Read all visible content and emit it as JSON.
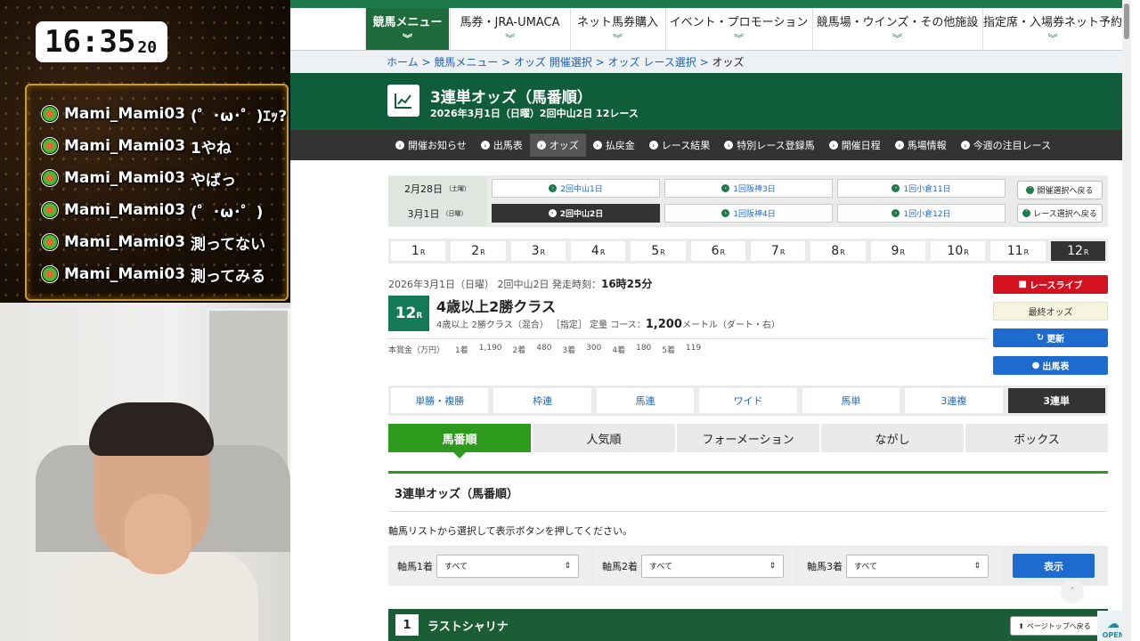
{
  "stream": {
    "clock": {
      "hm": "16:35",
      "ss": "20"
    },
    "chat": [
      {
        "user": "Mami_Mami03",
        "text": "(゜･ω･゜)ｴｯ?"
      },
      {
        "user": "Mami_Mami03",
        "text": "1やね"
      },
      {
        "user": "Mami_Mami03",
        "text": "やばっ"
      },
      {
        "user": "Mami_Mami03",
        "text": "(゜･ω･゜)"
      },
      {
        "user": "Mami_Mami03",
        "text": "測ってない"
      },
      {
        "user": "Mami_Mami03",
        "text": "測ってみる"
      }
    ]
  },
  "topnav": [
    {
      "label": "競馬メニュー"
    },
    {
      "label": "馬券・JRA-UMACA"
    },
    {
      "label": "ネット馬券購入"
    },
    {
      "label": "イベント・プロモーション"
    },
    {
      "label": "競馬場・ウインズ・その他施設"
    },
    {
      "label": "指定席・入場券ネット予約"
    }
  ],
  "breadcrumb": [
    "ホーム",
    "競馬メニュー",
    "オッズ 開催選択",
    "オッズ レース選択",
    "オッズ"
  ],
  "header": {
    "title": "3連単オッズ（馬番順）",
    "subtitle": "2026年3月1日（日曜）2回中山2日 12レース"
  },
  "subnav": [
    "開催お知らせ",
    "出馬表",
    "オッズ",
    "払戻金",
    "レース結果",
    "特別レース登録馬",
    "開催日程",
    "馬場情報",
    "今週の注目レース"
  ],
  "dates": [
    {
      "label": "2月28日",
      "dow": "（土曜）",
      "venues": [
        "2回中山1日",
        "1回阪神3日",
        "1回小倉11日"
      ]
    },
    {
      "label": "3月1日",
      "dow": "（日曜）",
      "venues": [
        "2回中山2日",
        "1回阪神4日",
        "1回小倉12日"
      ]
    }
  ],
  "back_buttons": [
    "開催選択へ戻る",
    "レース選択へ戻る"
  ],
  "races": [
    "1",
    "2",
    "3",
    "4",
    "5",
    "6",
    "7",
    "8",
    "9",
    "10",
    "11",
    "12"
  ],
  "race_suffix": "R",
  "race": {
    "date_line": "2026年3月1日（日曜） 2回中山2日 発走時刻：",
    "start_time": "16時25分",
    "num": "12",
    "name": "4歳以上2勝クラス",
    "conditions": "4歳以上 2勝クラス（混合） ［指定］ 定量 コース：",
    "distance": "1,200",
    "course_unit": "メートル（ダート・右）",
    "prize_label": "本賞金（万円）",
    "prizes": [
      {
        "place": "1着",
        "amount": "1,190"
      },
      {
        "place": "2着",
        "amount": "480"
      },
      {
        "place": "3着",
        "amount": "300"
      },
      {
        "place": "4着",
        "amount": "180"
      },
      {
        "place": "5着",
        "amount": "119"
      }
    ]
  },
  "side": {
    "live": "レースライブ",
    "final": "最終オッズ",
    "refresh": "更新",
    "entries": "出馬表"
  },
  "ticket_types": [
    "単勝・複勝",
    "枠連",
    "馬連",
    "ワイド",
    "馬単",
    "3連複",
    "3連単"
  ],
  "sort_tabs": [
    "馬番順",
    "人気順",
    "フォーメーション",
    "ながし",
    "ボックス"
  ],
  "section_title": "3連単オッズ（馬番順）",
  "instruction": "軸馬リストから選択して表示ボタンを押してください。",
  "filters": [
    {
      "label": "軸馬1着",
      "value": "すべて"
    },
    {
      "label": "軸馬2着",
      "value": "すべて"
    },
    {
      "label": "軸馬3着",
      "value": "すべて"
    }
  ],
  "show_button": "表示",
  "horse": {
    "num": "1",
    "name": "ラストシャリナ"
  },
  "page_top": "ページトップへ戻る",
  "open_label": "OPEN"
}
